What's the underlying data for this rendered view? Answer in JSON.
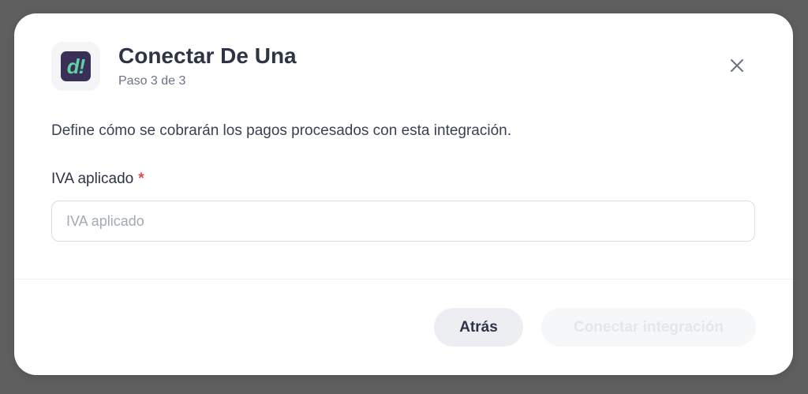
{
  "modal": {
    "title": "Conectar De Una",
    "subtitle": "Paso 3 de 3",
    "logo_text": "d!",
    "description": "Define cómo se cobrarán los pagos procesados con esta integración.",
    "close_icon": "close-icon"
  },
  "form": {
    "iva_label": "IVA aplicado",
    "required_marker": "*",
    "iva_placeholder": "IVA aplicado",
    "iva_value": ""
  },
  "footer": {
    "back_label": "Atrás",
    "connect_label": "Conectar integración",
    "connect_disabled": true
  },
  "colors": {
    "logo_bg": "#3a2f57",
    "logo_fg": "#5fd3a4",
    "required": "#e5484d",
    "title": "#2d3445"
  }
}
